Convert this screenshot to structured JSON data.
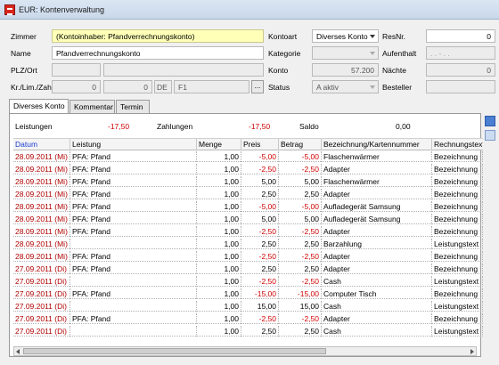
{
  "window": {
    "title": "EUR: Kontenverwaltung"
  },
  "form": {
    "zimmer": {
      "label": "Zimmer",
      "value": "(Kontoinhaber: Pfandverrechnungskonto)"
    },
    "name": {
      "label": "Name",
      "value": "Pfandverrechnungskonto"
    },
    "plzort": {
      "label": "PLZ/Ort"
    },
    "krlimzah": {
      "label": "Kr./Lim./Zah",
      "credit": "0",
      "limit": "0",
      "country": "DE",
      "fkey": "F1",
      "browse": "..."
    },
    "kontoart": {
      "label": "Kontoart",
      "value": "Diverses Konto"
    },
    "kategorie": {
      "label": "Kategorie",
      "value": ""
    },
    "konto": {
      "label": "Konto",
      "value": "57.200"
    },
    "status": {
      "label": "Status",
      "value": "A aktiv"
    },
    "resnr": {
      "label": "ResNr.",
      "value": "0"
    },
    "aufenthalt": {
      "label": "Aufenthalt",
      "value": ". . - . ."
    },
    "naechte": {
      "label": "Nächte",
      "value": "0"
    },
    "besteller": {
      "label": "Besteller",
      "value": ""
    }
  },
  "tabs": [
    {
      "label": "Diverses Konto",
      "active": true
    },
    {
      "label": "Kommentar",
      "active": false
    },
    {
      "label": "Termin",
      "active": false
    }
  ],
  "summary": {
    "leistungen_label": "Leistungen",
    "leistungen_value": "-17,50",
    "zahlungen_label": "Zahlungen",
    "zahlungen_value": "-17,50",
    "saldo_label": "Saldo",
    "saldo_value": "0,00"
  },
  "table": {
    "columns": [
      "Datum",
      "Leistung",
      "Menge",
      "Preis",
      "Betrag",
      "Bezeichnung/Kartennummer",
      "Rechnungstext"
    ],
    "rows": [
      {
        "datum": "28.09.2011 (Mi)",
        "leistung": "PFA: Pfand",
        "menge": "1,00",
        "preis": "-5,00",
        "betrag": "-5,00",
        "bezeichnung": "Flaschenwärmer",
        "text": "Bezeichnung",
        "neg": true
      },
      {
        "datum": "28.09.2011 (Mi)",
        "leistung": "PFA: Pfand",
        "menge": "1,00",
        "preis": "-2,50",
        "betrag": "-2,50",
        "bezeichnung": "Adapter",
        "text": "Bezeichnung",
        "neg": true
      },
      {
        "datum": "28.09.2011 (Mi)",
        "leistung": "PFA: Pfand",
        "menge": "1,00",
        "preis": "5,00",
        "betrag": "5,00",
        "bezeichnung": "Flaschenwärmer",
        "text": "Bezeichnung",
        "neg": false
      },
      {
        "datum": "28.09.2011 (Mi)",
        "leistung": "PFA: Pfand",
        "menge": "1,00",
        "preis": "2,50",
        "betrag": "2,50",
        "bezeichnung": "Adapter",
        "text": "Bezeichnung",
        "neg": false
      },
      {
        "datum": "28.09.2011 (Mi)",
        "leistung": "PFA: Pfand",
        "menge": "1,00",
        "preis": "-5,00",
        "betrag": "-5,00",
        "bezeichnung": "Aufladegerät Samsung",
        "text": "Bezeichnung",
        "neg": true
      },
      {
        "datum": "28.09.2011 (Mi)",
        "leistung": "PFA: Pfand",
        "menge": "1,00",
        "preis": "5,00",
        "betrag": "5,00",
        "bezeichnung": "Aufladegerät Samsung",
        "text": "Bezeichnung",
        "neg": false
      },
      {
        "datum": "28.09.2011 (Mi)",
        "leistung": "PFA: Pfand",
        "menge": "1,00",
        "preis": "-2,50",
        "betrag": "-2,50",
        "bezeichnung": "Adapter",
        "text": "Bezeichnung",
        "neg": true
      },
      {
        "datum": "28.09.2011 (Mi)",
        "leistung": "",
        "menge": "1,00",
        "preis": "2,50",
        "betrag": "2,50",
        "bezeichnung": "Barzahlung",
        "text": "Leistungstext",
        "neg": false
      },
      {
        "datum": "28.09.2011 (Mi)",
        "leistung": "PFA: Pfand",
        "menge": "1,00",
        "preis": "-2,50",
        "betrag": "-2,50",
        "bezeichnung": "Adapter",
        "text": "Bezeichnung",
        "neg": true
      },
      {
        "datum": "27.09.2011 (Di)",
        "leistung": "PFA: Pfand",
        "menge": "1,00",
        "preis": "2,50",
        "betrag": "2,50",
        "bezeichnung": "Adapter",
        "text": "Bezeichnung",
        "neg": false
      },
      {
        "datum": "27.09.2011 (Di)",
        "leistung": "",
        "menge": "1,00",
        "preis": "-2,50",
        "betrag": "-2,50",
        "bezeichnung": "Cash",
        "text": "Leistungstext",
        "neg": true
      },
      {
        "datum": "27.09.2011 (Di)",
        "leistung": "PFA: Pfand",
        "menge": "1,00",
        "preis": "-15,00",
        "betrag": "-15,00",
        "bezeichnung": "Computer Tisch",
        "text": "Bezeichnung",
        "neg": true
      },
      {
        "datum": "27.09.2011 (Di)",
        "leistung": "",
        "menge": "1,00",
        "preis": "15,00",
        "betrag": "15,00",
        "bezeichnung": "Cash",
        "text": "Leistungstext",
        "neg": false
      },
      {
        "datum": "27.09.2011 (Di)",
        "leistung": "PFA: Pfand",
        "menge": "1,00",
        "preis": "-2,50",
        "betrag": "-2,50",
        "bezeichnung": "Adapter",
        "text": "Bezeichnung",
        "neg": true
      },
      {
        "datum": "27.09.2011 (Di)",
        "leistung": "",
        "menge": "1,00",
        "preis": "2,50",
        "betrag": "2,50",
        "bezeichnung": "Cash",
        "text": "Leistungstext",
        "neg": false
      }
    ]
  },
  "colors": {
    "negative": "#d10000",
    "date": "#b00000",
    "header_link": "#1a3bd1"
  }
}
